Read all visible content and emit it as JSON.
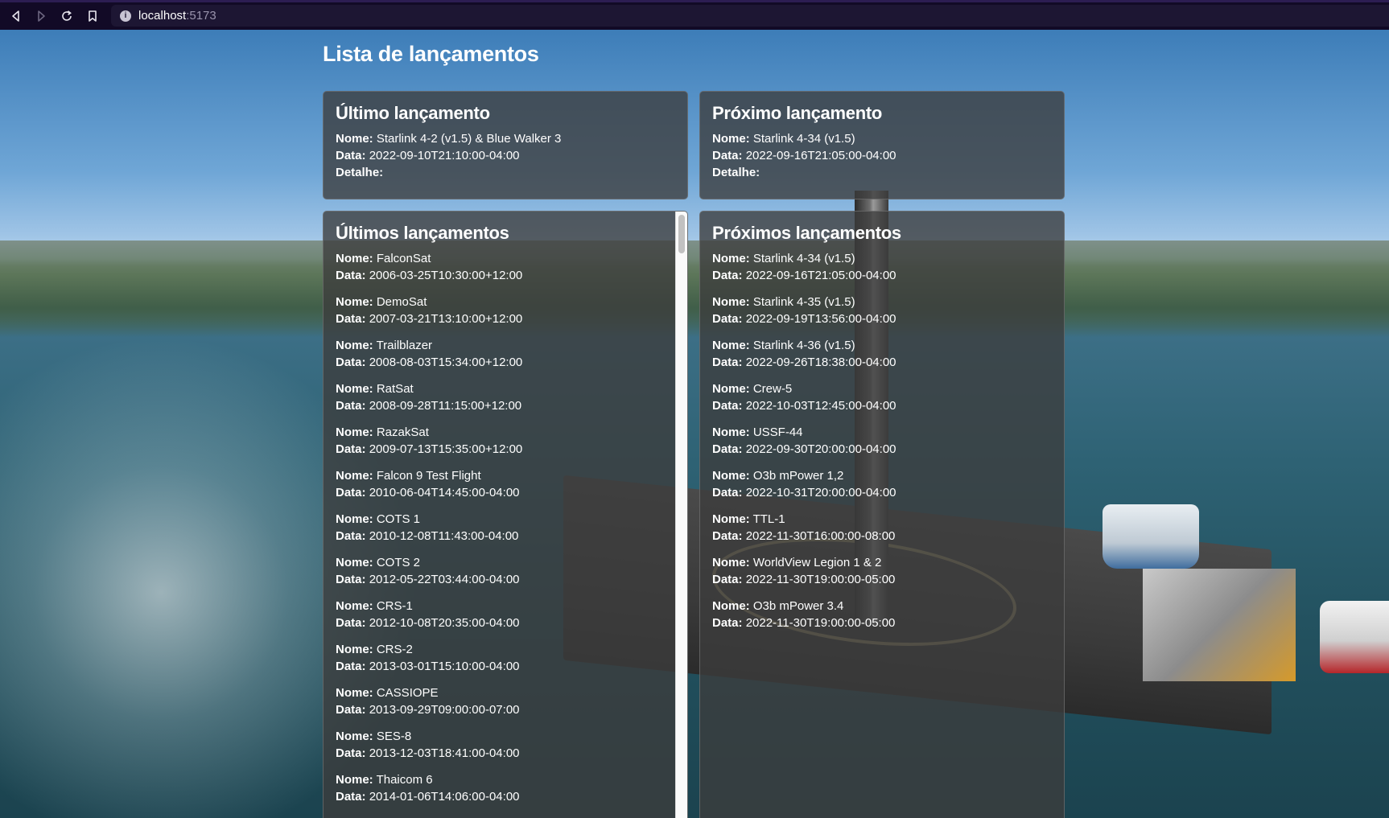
{
  "browser": {
    "url_host": "localhost",
    "url_port": ":5173",
    "info_icon": "i"
  },
  "page": {
    "title": "Lista de lançamentos"
  },
  "labels": {
    "name": "Nome:",
    "date": "Data:",
    "detail": "Detalhe:"
  },
  "last_launch": {
    "heading": "Último lançamento",
    "name": "Starlink 4-2 (v1.5) & Blue Walker 3",
    "date": "2022-09-10T21:10:00-04:00",
    "detail": ""
  },
  "next_launch": {
    "heading": "Próximo lançamento",
    "name": "Starlink 4-34 (v1.5)",
    "date": "2022-09-16T21:05:00-04:00",
    "detail": ""
  },
  "past_launches": {
    "heading": "Últimos lançamentos",
    "items": [
      {
        "name": "FalconSat",
        "date": "2006-03-25T10:30:00+12:00"
      },
      {
        "name": "DemoSat",
        "date": "2007-03-21T13:10:00+12:00"
      },
      {
        "name": "Trailblazer",
        "date": "2008-08-03T15:34:00+12:00"
      },
      {
        "name": "RatSat",
        "date": "2008-09-28T11:15:00+12:00"
      },
      {
        "name": "RazakSat",
        "date": "2009-07-13T15:35:00+12:00"
      },
      {
        "name": "Falcon 9 Test Flight",
        "date": "2010-06-04T14:45:00-04:00"
      },
      {
        "name": "COTS 1",
        "date": "2010-12-08T11:43:00-04:00"
      },
      {
        "name": "COTS 2",
        "date": "2012-05-22T03:44:00-04:00"
      },
      {
        "name": "CRS-1",
        "date": "2012-10-08T20:35:00-04:00"
      },
      {
        "name": "CRS-2",
        "date": "2013-03-01T15:10:00-04:00"
      },
      {
        "name": "CASSIOPE",
        "date": "2013-09-29T09:00:00-07:00"
      },
      {
        "name": "SES-8",
        "date": "2013-12-03T18:41:00-04:00"
      },
      {
        "name": "Thaicom 6",
        "date": "2014-01-06T14:06:00-04:00"
      }
    ]
  },
  "upcoming_launches": {
    "heading": "Próximos lançamentos",
    "items": [
      {
        "name": "Starlink 4-34 (v1.5)",
        "date": "2022-09-16T21:05:00-04:00"
      },
      {
        "name": "Starlink 4-35 (v1.5)",
        "date": "2022-09-19T13:56:00-04:00"
      },
      {
        "name": "Starlink 4-36 (v1.5)",
        "date": "2022-09-26T18:38:00-04:00"
      },
      {
        "name": "Crew-5",
        "date": "2022-10-03T12:45:00-04:00"
      },
      {
        "name": "USSF-44",
        "date": "2022-09-30T20:00:00-04:00"
      },
      {
        "name": "O3b mPower 1,2",
        "date": "2022-10-31T20:00:00-04:00"
      },
      {
        "name": "TTL-1",
        "date": "2022-11-30T16:00:00-08:00"
      },
      {
        "name": "WorldView Legion 1 & 2",
        "date": "2022-11-30T19:00:00-05:00"
      },
      {
        "name": "O3b mPower 3.4",
        "date": "2022-11-30T19:00:00-05:00"
      }
    ]
  }
}
